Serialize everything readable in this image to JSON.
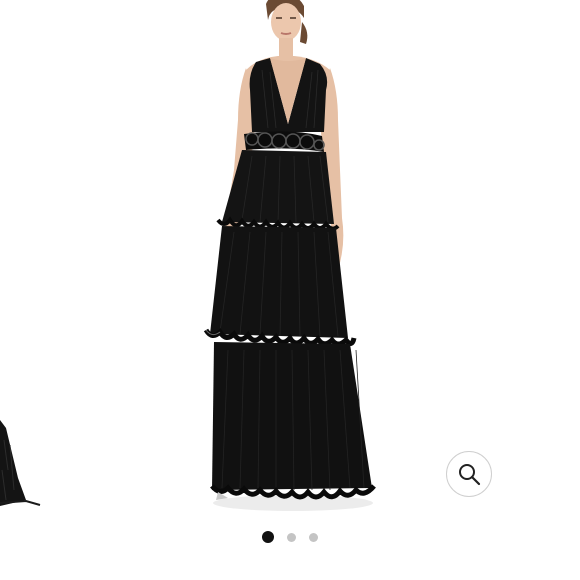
{
  "gallery": {
    "image_name": "black-tiered-pleated-gown",
    "zoom_icon": "magnifier-icon",
    "slide_count": 3,
    "active_slide": 1
  },
  "colors": {
    "dress": "#111111",
    "skin": "#e6c0a5",
    "dot_active": "#111111",
    "dot_inactive": "#c4c4c4"
  }
}
